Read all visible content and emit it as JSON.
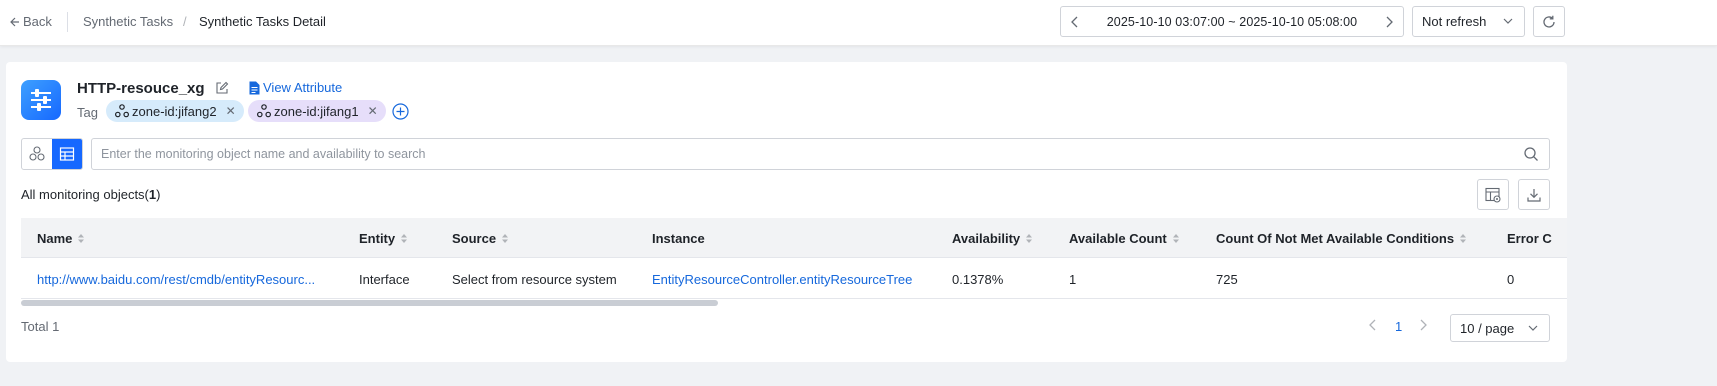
{
  "header": {
    "back_label": "Back",
    "breadcrumb": [
      "Synthetic Tasks",
      "/",
      "Synthetic Tasks Detail"
    ],
    "time_range": "2025-10-10 03:07:00 ~ 2025-10-10 05:08:00",
    "refresh_option": "Not refresh"
  },
  "task": {
    "name": "HTTP-resouce_xg",
    "view_attribute_label": "View Attribute",
    "tag_label": "Tag",
    "tags": [
      "zone-id:jifang2",
      "zone-id:jifang1"
    ]
  },
  "search": {
    "placeholder": "Enter the monitoring object name and availability to search"
  },
  "summary": {
    "label": "All monitoring objects(",
    "count": "1",
    "suffix": ")"
  },
  "table": {
    "columns": [
      "Name",
      "Entity",
      "Source",
      "Instance",
      "Availability",
      "Available Count",
      "Count Of Not Met Available Conditions",
      "Error C"
    ],
    "rows": [
      {
        "name": "http://www.baidu.com/rest/cmdb/entityResourc...",
        "entity": "Interface",
        "source": "Select from resource system",
        "instance": "EntityResourceController.entityResourceTree",
        "availability": "0.1378%",
        "available_count": "1",
        "not_met_count": "725",
        "error_count": "0"
      }
    ]
  },
  "pagination": {
    "total": "Total 1",
    "current_page": "1",
    "page_size": "10 / page"
  },
  "colors": {
    "primary": "#1668ff",
    "link": "#1668dc",
    "tag1_bg": "#d6ebfb",
    "tag2_bg": "#e6defa"
  }
}
